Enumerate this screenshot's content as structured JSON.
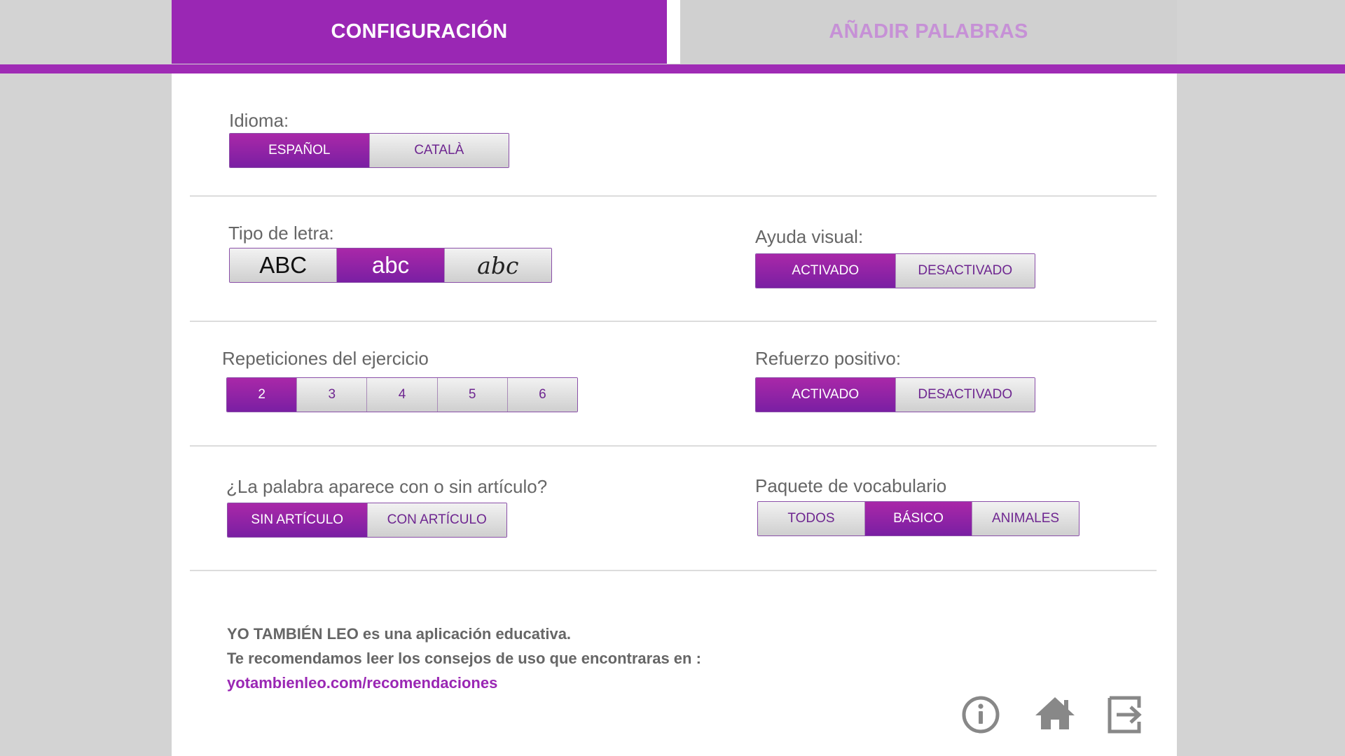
{
  "tabs": {
    "config_label": "CONFIGURACIÓN",
    "add_words_label": "AÑADIR PALABRAS"
  },
  "colors": {
    "accent": "#9a27b4",
    "selected_gradient_top": "#a928a8",
    "selected_gradient_bottom": "#7a1fa3",
    "inactive_tab_text": "#c691d6"
  },
  "language": {
    "label": "Idioma:",
    "options": [
      "ESPAÑOL",
      "CATALÀ"
    ],
    "selected": "ESPAÑOL"
  },
  "font_type": {
    "label": "Tipo de letra:",
    "options": [
      "ABC",
      "abc",
      "abc"
    ],
    "selected_index": 1
  },
  "visual_help": {
    "label": "Ayuda visual:",
    "options": [
      "ACTIVADO",
      "DESACTIVADO"
    ],
    "selected": "ACTIVADO"
  },
  "repetitions": {
    "label": "Repeticiones del ejercicio",
    "options": [
      "2",
      "3",
      "4",
      "5",
      "6"
    ],
    "selected": "2"
  },
  "positive_reinforcement": {
    "label": "Refuerzo positivo:",
    "options": [
      "ACTIVADO",
      "DESACTIVADO"
    ],
    "selected": "ACTIVADO"
  },
  "article": {
    "label": "¿La palabra aparece con o sin artículo?",
    "options": [
      "SIN ARTÍCULO",
      "CON ARTÍCULO"
    ],
    "selected": "SIN ARTÍCULO"
  },
  "vocabulary": {
    "label": "Paquete de vocabulario",
    "options": [
      "TODOS",
      "BÁSICO",
      "ANIMALES"
    ],
    "selected": "BÁSICO"
  },
  "footer": {
    "line1": "YO TAMBIÉN LEO es una aplicación educativa.",
    "line2": "Te recomendamos leer los consejos de uso que encontraras en :",
    "link": "yotambienleo.com/recomendaciones"
  },
  "icons": {
    "info": "info-icon",
    "home": "home-icon",
    "exit": "exit-icon"
  }
}
